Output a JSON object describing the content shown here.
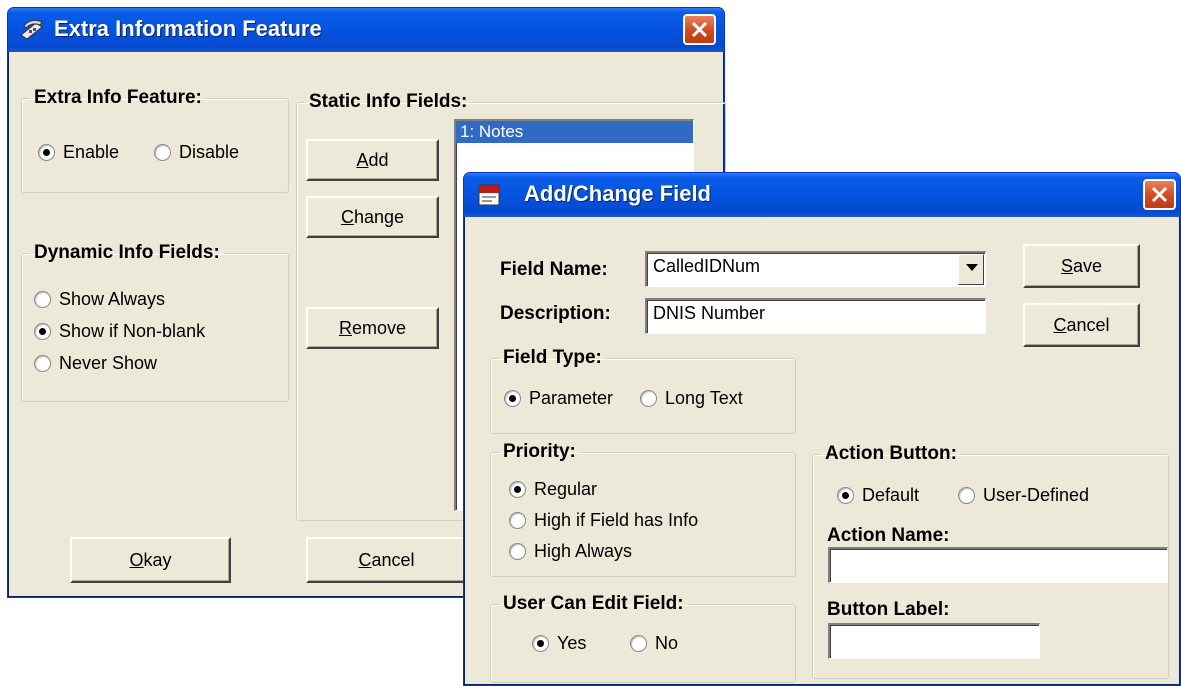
{
  "win1": {
    "title": "Extra Information Feature",
    "extra_info": {
      "legend": "Extra Info Feature:",
      "options": [
        {
          "label": "Enable",
          "selected": true
        },
        {
          "label": "Disable",
          "selected": false
        }
      ]
    },
    "dynamic": {
      "legend": "Dynamic Info Fields:",
      "options": [
        {
          "label": "Show Always",
          "selected": false
        },
        {
          "label": "Show if Non-blank",
          "selected": true
        },
        {
          "label": "Never Show",
          "selected": false
        }
      ]
    },
    "static": {
      "legend": "Static Info Fields:",
      "buttons": {
        "add_u": "A",
        "add_rest": "dd",
        "change_u": "C",
        "change_rest": "hange",
        "remove_u": "R",
        "remove_rest": "emove"
      },
      "list": [
        "1: Notes"
      ]
    },
    "okay_u": "O",
    "okay_rest": "kay",
    "cancel_u": "C",
    "cancel_rest": "ancel"
  },
  "win2": {
    "title": "Add/Change Field",
    "field_name_label": "Field Name:",
    "field_name_value": "CalledIDNum",
    "description_label": "Description:",
    "description_value": "DNIS Number",
    "save_u": "S",
    "save_rest": "ave",
    "cancel_u": "C",
    "cancel_rest": "ancel",
    "field_type": {
      "legend": "Field Type:",
      "options": [
        {
          "label": "Parameter",
          "selected": true
        },
        {
          "label": "Long Text",
          "selected": false
        }
      ]
    },
    "priority": {
      "legend": "Priority:",
      "options": [
        {
          "label": "Regular",
          "selected": true
        },
        {
          "label": "High if Field has Info",
          "selected": false
        },
        {
          "label": "High Always",
          "selected": false
        }
      ]
    },
    "user_edit": {
      "legend": "User Can Edit Field:",
      "options": [
        {
          "label": "Yes",
          "selected": true
        },
        {
          "label": "No",
          "selected": false
        }
      ]
    },
    "action_button": {
      "legend": "Action Button:",
      "options": [
        {
          "label": "Default",
          "selected": true
        },
        {
          "label": "User-Defined",
          "selected": false
        }
      ],
      "action_name_label": "Action Name:",
      "action_name_value": "",
      "button_label_label": "Button Label:",
      "button_label_value": ""
    }
  },
  "colors": {
    "titlebar": "#0553E0",
    "dialog_bg": "#ECE9D8",
    "selection": "#316AC5",
    "close": "#D24A22"
  }
}
